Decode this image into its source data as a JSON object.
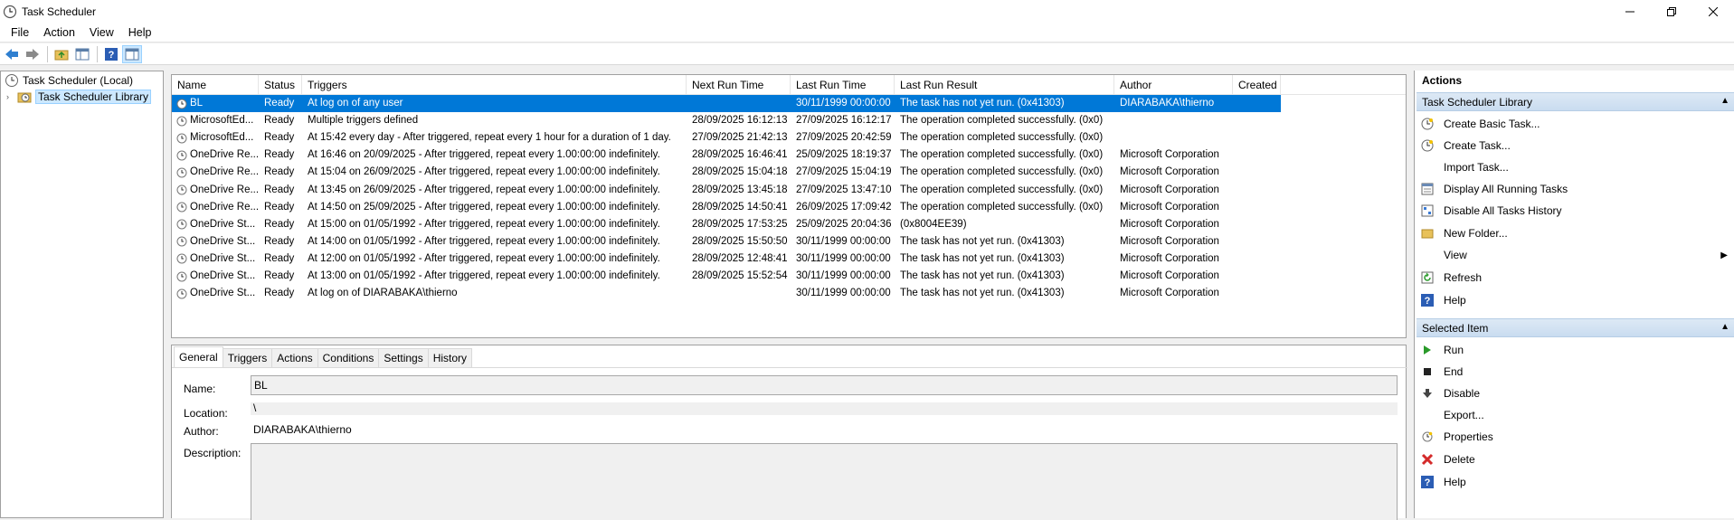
{
  "window": {
    "title": "Task Scheduler"
  },
  "menu": [
    "File",
    "Action",
    "View",
    "Help"
  ],
  "tree": {
    "root": "Task Scheduler (Local)",
    "child": "Task Scheduler Library"
  },
  "columns": [
    "Name",
    "Status",
    "Triggers",
    "Next Run Time",
    "Last Run Time",
    "Last Run Result",
    "Author",
    "Created"
  ],
  "tasks": [
    {
      "name": "BL",
      "status": "Ready",
      "triggers": "At log on of any user",
      "next": "",
      "last": "30/11/1999 00:00:00",
      "result": "The task has not yet run. (0x41303)",
      "author": "DIARABAKA\\thierno",
      "created": ""
    },
    {
      "name": "MicrosoftEd...",
      "status": "Ready",
      "triggers": "Multiple triggers defined",
      "next": "28/09/2025 16:12:13",
      "last": "27/09/2025 16:12:17",
      "result": "The operation completed successfully. (0x0)",
      "author": "",
      "created": ""
    },
    {
      "name": "MicrosoftEd...",
      "status": "Ready",
      "triggers": "At 15:42 every day - After triggered, repeat every 1 hour for a duration of 1 day.",
      "next": "27/09/2025 21:42:13",
      "last": "27/09/2025 20:42:59",
      "result": "The operation completed successfully. (0x0)",
      "author": "",
      "created": ""
    },
    {
      "name": "OneDrive Re...",
      "status": "Ready",
      "triggers": "At 16:46 on 20/09/2025 - After triggered, repeat every 1.00:00:00 indefinitely.",
      "next": "28/09/2025 16:46:41",
      "last": "25/09/2025 18:19:37",
      "result": "The operation completed successfully. (0x0)",
      "author": "Microsoft Corporation",
      "created": ""
    },
    {
      "name": "OneDrive Re...",
      "status": "Ready",
      "triggers": "At 15:04 on 26/09/2025 - After triggered, repeat every 1.00:00:00 indefinitely.",
      "next": "28/09/2025 15:04:18",
      "last": "27/09/2025 15:04:19",
      "result": "The operation completed successfully. (0x0)",
      "author": "Microsoft Corporation",
      "created": ""
    },
    {
      "name": "OneDrive Re...",
      "status": "Ready",
      "triggers": "At 13:45 on 26/09/2025 - After triggered, repeat every 1.00:00:00 indefinitely.",
      "next": "28/09/2025 13:45:18",
      "last": "27/09/2025 13:47:10",
      "result": "The operation completed successfully. (0x0)",
      "author": "Microsoft Corporation",
      "created": ""
    },
    {
      "name": "OneDrive Re...",
      "status": "Ready",
      "triggers": "At 14:50 on 25/09/2025 - After triggered, repeat every 1.00:00:00 indefinitely.",
      "next": "28/09/2025 14:50:41",
      "last": "26/09/2025 17:09:42",
      "result": "The operation completed successfully. (0x0)",
      "author": "Microsoft Corporation",
      "created": ""
    },
    {
      "name": "OneDrive St...",
      "status": "Ready",
      "triggers": "At 15:00 on 01/05/1992 - After triggered, repeat every 1.00:00:00 indefinitely.",
      "next": "28/09/2025 17:53:25",
      "last": "25/09/2025 20:04:36",
      "result": "(0x8004EE39)",
      "author": "Microsoft Corporation",
      "created": ""
    },
    {
      "name": "OneDrive St...",
      "status": "Ready",
      "triggers": "At 14:00 on 01/05/1992 - After triggered, repeat every 1.00:00:00 indefinitely.",
      "next": "28/09/2025 15:50:50",
      "last": "30/11/1999 00:00:00",
      "result": "The task has not yet run. (0x41303)",
      "author": "Microsoft Corporation",
      "created": ""
    },
    {
      "name": "OneDrive St...",
      "status": "Ready",
      "triggers": "At 12:00 on 01/05/1992 - After triggered, repeat every 1.00:00:00 indefinitely.",
      "next": "28/09/2025 12:48:41",
      "last": "30/11/1999 00:00:00",
      "result": "The task has not yet run. (0x41303)",
      "author": "Microsoft Corporation",
      "created": ""
    },
    {
      "name": "OneDrive St...",
      "status": "Ready",
      "triggers": "At 13:00 on 01/05/1992 - After triggered, repeat every 1.00:00:00 indefinitely.",
      "next": "28/09/2025 15:52:54",
      "last": "30/11/1999 00:00:00",
      "result": "The task has not yet run. (0x41303)",
      "author": "Microsoft Corporation",
      "created": ""
    },
    {
      "name": "OneDrive St...",
      "status": "Ready",
      "triggers": "At log on of DIARABAKA\\thierno",
      "next": "",
      "last": "30/11/1999 00:00:00",
      "result": "The task has not yet run. (0x41303)",
      "author": "Microsoft Corporation",
      "created": ""
    }
  ],
  "detail": {
    "tabs": [
      "General",
      "Triggers",
      "Actions",
      "Conditions",
      "Settings",
      "History"
    ],
    "name_label": "Name:",
    "name_value": "BL",
    "location_label": "Location:",
    "location_value": "\\",
    "author_label": "Author:",
    "author_value": "DIARABAKA\\thierno",
    "description_label": "Description:",
    "description_value": ""
  },
  "actions": {
    "title": "Actions",
    "section1": "Task Scheduler Library",
    "items1": [
      "Create Basic Task...",
      "Create Task...",
      "Import Task...",
      "Display All Running Tasks",
      "Disable All Tasks History",
      "New Folder...",
      "View",
      "Refresh",
      "Help"
    ],
    "section2": "Selected Item",
    "items2": [
      "Run",
      "End",
      "Disable",
      "Export...",
      "Properties",
      "Delete",
      "Help"
    ]
  },
  "colors": {
    "selection": "#0078d7",
    "accent_header": "#c9dcf0"
  }
}
